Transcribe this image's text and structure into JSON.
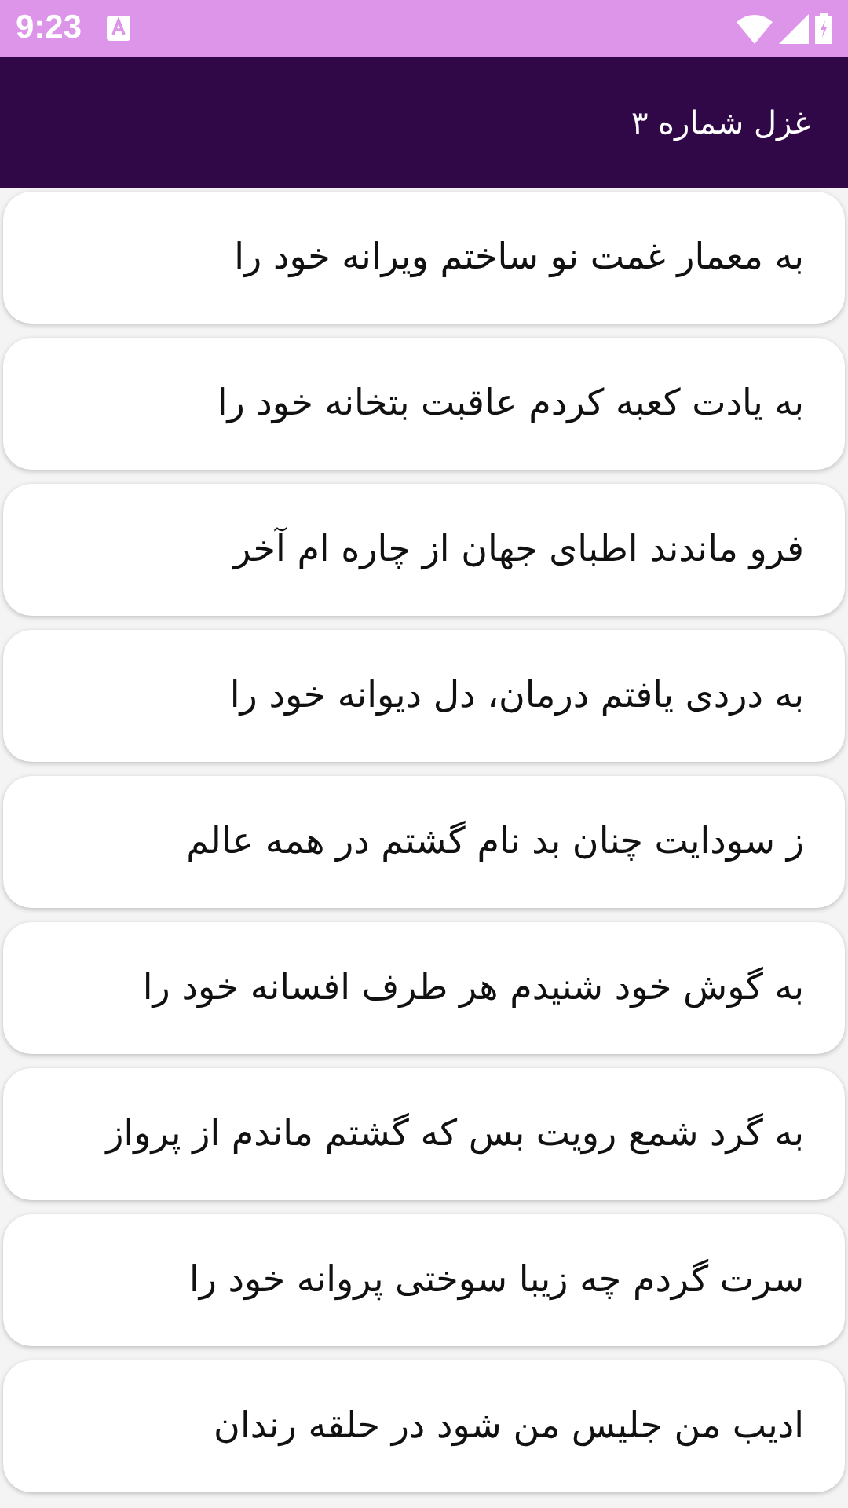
{
  "status_bar": {
    "time": "9:23"
  },
  "app_bar": {
    "title": "غزل شماره ۳"
  },
  "verses": [
    {
      "text": "به معمار غمت نو ساختم ویرانه خود را"
    },
    {
      "text": "به یادت کعبه کردم عاقبت بتخانه خود را"
    },
    {
      "text": "فرو ماندند اطبای جهان از چاره ام آخر"
    },
    {
      "text": "به دردی یافتم درمان، دل دیوانه خود را"
    },
    {
      "text": "ز سودایت چنان بد نام گشتم در همه عالم"
    },
    {
      "text": "به گوش خود شنیدم هر طرف افسانه خود را"
    },
    {
      "text": "به گرد شمع رویت بس که گشتم ماندم از پرواز"
    },
    {
      "text": "سرت گردم چه زیبا سوختی پروانه خود را"
    },
    {
      "text": "ادیب من جلیس من شود در حلقه رندان"
    }
  ]
}
